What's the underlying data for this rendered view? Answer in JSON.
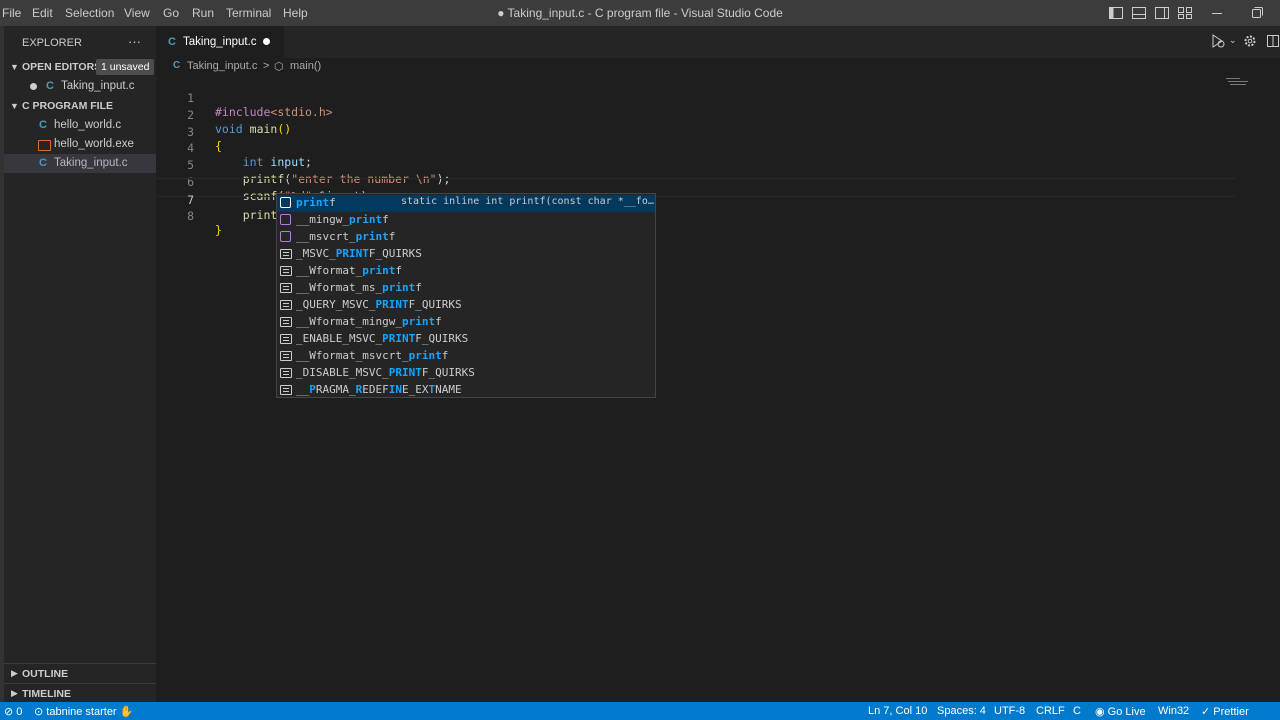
{
  "menu": [
    "File",
    "Edit",
    "Selection",
    "View",
    "Go",
    "Run",
    "Terminal",
    "Help"
  ],
  "window_title": "● Taking_input.c - C program file - Visual Studio Code",
  "sidebar": {
    "title": "EXPLORER",
    "more": "···",
    "open_editors": {
      "label": "OPEN EDITORS",
      "badge": "1 unsaved",
      "items": [
        {
          "name": "Taking_input.c",
          "dirty": true
        }
      ]
    },
    "folder": {
      "label": "C PROGRAM FILE",
      "items": [
        {
          "name": "hello_world.c",
          "type": "c"
        },
        {
          "name": "hello_world.exe",
          "type": "exe"
        },
        {
          "name": "Taking_input.c",
          "type": "c",
          "selected": true
        }
      ]
    },
    "outline": "OUTLINE",
    "timeline": "TIMELINE"
  },
  "tab": {
    "label": "Taking_input.c",
    "modified": true
  },
  "breadcrumb": {
    "file": "Taking_input.c",
    "separator": ">",
    "symbol": "main()"
  },
  "editor": {
    "lines": [
      {
        "n": "1",
        "text": "#include<stdio.h>"
      },
      {
        "n": "2",
        "text": "void main()"
      },
      {
        "n": "3",
        "text": "{"
      },
      {
        "n": "4",
        "text": "    int input;"
      },
      {
        "n": "5",
        "text": "    printf(\"enter the number \\n\");"
      },
      {
        "n": "6",
        "text": "    scanf(\"%d\",&input);"
      },
      {
        "n": "7",
        "text": "    print",
        "ghost": "f(\"\\n\");"
      },
      {
        "n": "8",
        "text": "}"
      }
    ],
    "current_line": 7
  },
  "suggestions": {
    "query": "print",
    "detail": "static inline int printf(const char *__fo…",
    "items": [
      {
        "label": "printf",
        "kind": "function",
        "selected": true
      },
      {
        "label": "__mingw_printf",
        "kind": "function"
      },
      {
        "label": "__msvcrt_printf",
        "kind": "function"
      },
      {
        "label": "_MSVC_PRINTF_QUIRKS",
        "kind": "constant"
      },
      {
        "label": "__Wformat_printf",
        "kind": "constant"
      },
      {
        "label": "__Wformat_ms_printf",
        "kind": "constant"
      },
      {
        "label": "_QUERY_MSVC_PRINTF_QUIRKS",
        "kind": "constant"
      },
      {
        "label": "__Wformat_mingw_printf",
        "kind": "constant"
      },
      {
        "label": "_ENABLE_MSVC_PRINTF_QUIRKS",
        "kind": "constant"
      },
      {
        "label": "__Wformat_msvcrt_printf",
        "kind": "constant"
      },
      {
        "label": "_DISABLE_MSVC_PRINTF_QUIRKS",
        "kind": "constant"
      },
      {
        "label": "__PRAGMA_REDEFINE_EXTNAME",
        "kind": "constant"
      }
    ]
  },
  "statusbar": {
    "problems": "0",
    "tabnine": "tabnine starter",
    "position": "Ln 7, Col 10",
    "spaces": "Spaces: 4",
    "encoding": "UTF-8",
    "eol": "CRLF",
    "language": "C",
    "golive": "Go Live",
    "platform": "Win32",
    "prettier": "Prettier"
  },
  "colors": {
    "accent": "#007acc",
    "selection": "#04395e",
    "match": "#18a3ff"
  }
}
